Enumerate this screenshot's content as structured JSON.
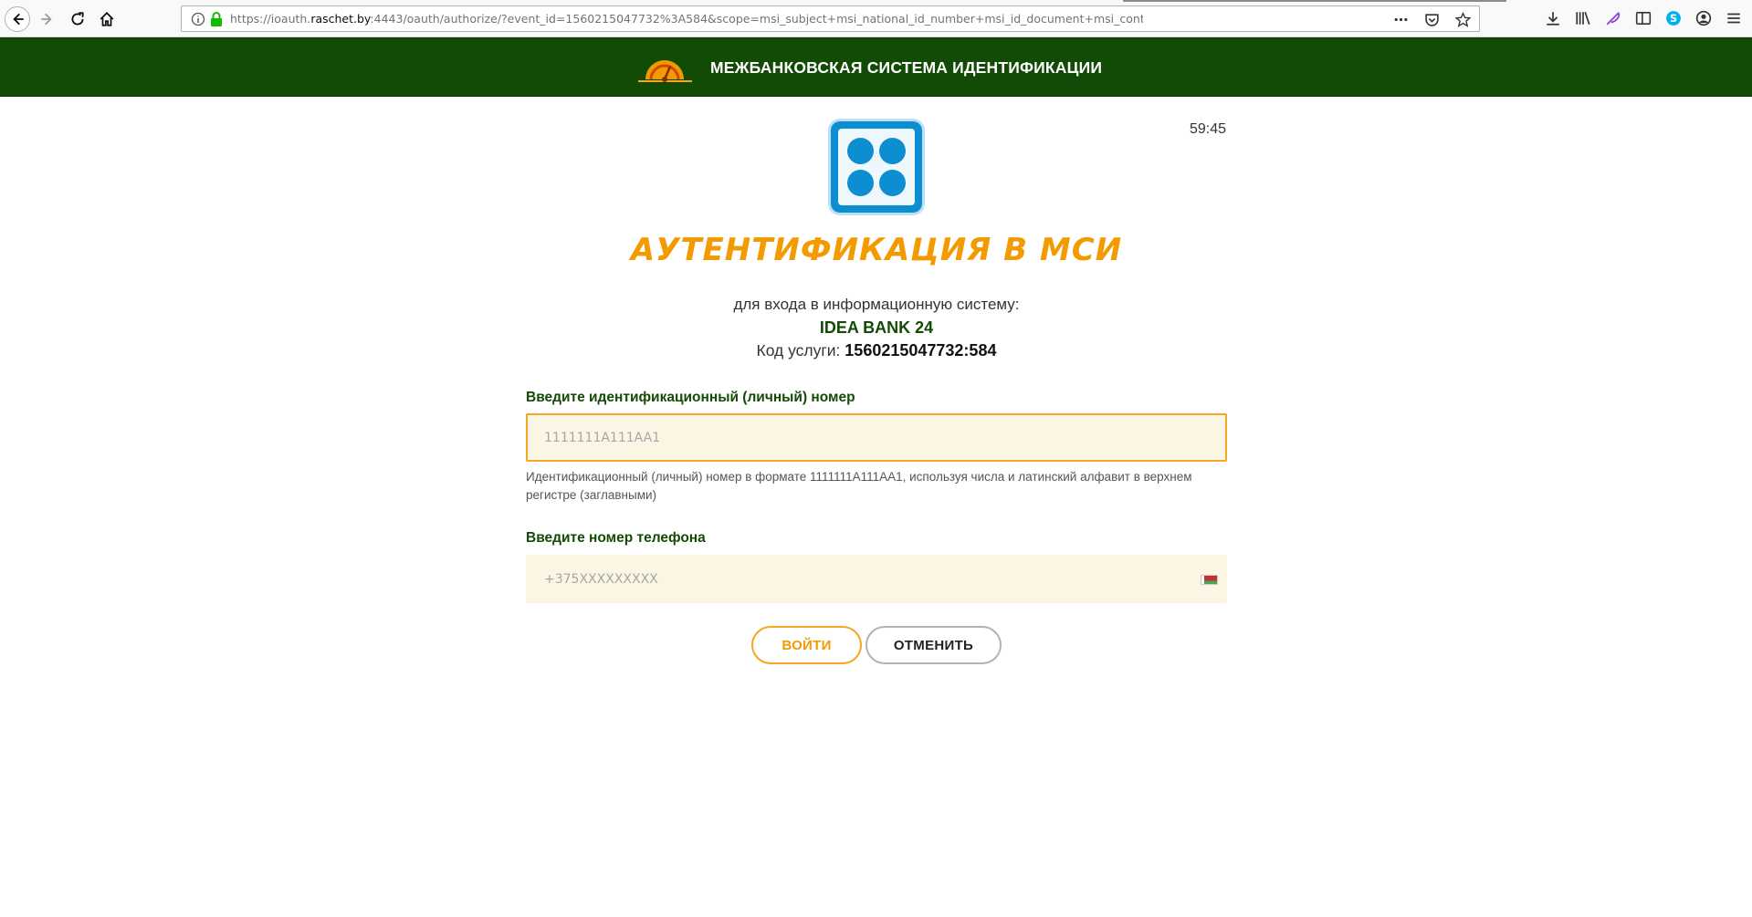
{
  "browser": {
    "url_prefix": "https://ioauth.",
    "url_domain": "raschet.by",
    "url_rest": ":4443/oauth/authorize/?event_id=1560215047732%3A584&scope=msi_subject+msi_national_id_number+msi_id_document+msi_contact+msi_user_registration_info+msi_session_",
    "overflow_label": "•••"
  },
  "header": {
    "title": "МЕЖБАНКОВСКАЯ СИСТЕМА ИДЕНТИФИКАЦИИ"
  },
  "auth": {
    "timer": "59:45",
    "title": "АУТЕНТИФИКАЦИЯ В МСИ",
    "subtitle": "для входа в информационную систему:",
    "system_name": "IDEA BANK 24",
    "service_code_label": "Код услуги:",
    "service_code_value": "1560215047732:584"
  },
  "form": {
    "id_label": "Введите идентификационный (личный) номер",
    "id_placeholder": "1111111A111AA1",
    "id_hint": "Идентификационный (личный) номер в формате 1111111A111AA1, используя числа и латинский алфавит в верхнем регистре (заглавными)",
    "phone_label": "Введите номер телефона",
    "phone_placeholder": "+375XXXXXXXXX",
    "login_button": "ВОЙТИ",
    "cancel_button": "ОТМЕНИТЬ"
  },
  "colors": {
    "header_bg": "#124b05",
    "accent": "#f29a00",
    "input_bg": "#fbf6e4",
    "app_logo": "#0d8ed0"
  },
  "icons": [
    "back-icon",
    "forward-icon",
    "reload-icon",
    "home-icon",
    "info-icon",
    "lock-icon",
    "pocket-icon",
    "bookmark-star-icon",
    "download-icon",
    "library-icon",
    "feather-icon",
    "sidebar-icon",
    "skype-icon",
    "account-icon",
    "menu-icon",
    "msi-logo",
    "belarus-flag-icon"
  ]
}
